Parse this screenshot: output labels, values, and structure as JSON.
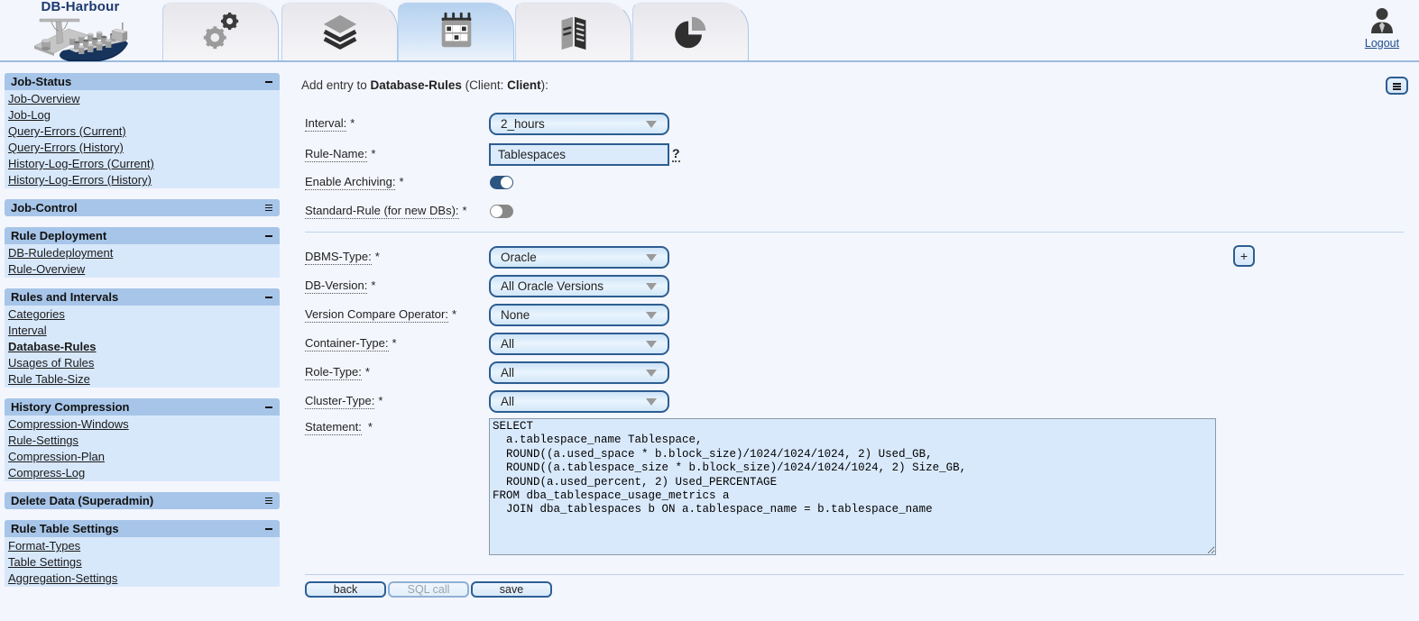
{
  "app": {
    "name": "DB-Harbour",
    "logout_label": "Logout"
  },
  "tabs": [
    {
      "id": "settings",
      "icon": "gears-icon",
      "active": false
    },
    {
      "id": "layers",
      "icon": "layers-icon",
      "active": false
    },
    {
      "id": "scheduler",
      "icon": "calendar-icon",
      "active": true
    },
    {
      "id": "reports",
      "icon": "report-icon",
      "active": false
    },
    {
      "id": "statistics",
      "icon": "pie-chart-icon",
      "active": false
    }
  ],
  "sidebar": {
    "sections": [
      {
        "title": "Job-Status",
        "state": "expanded",
        "items": [
          {
            "label": "Job-Overview"
          },
          {
            "label": "Job-Log"
          },
          {
            "label": "Query-Errors (Current)"
          },
          {
            "label": "Query-Errors (History)"
          },
          {
            "label": "History-Log-Errors (Current)"
          },
          {
            "label": "History-Log-Errors (History)"
          }
        ]
      },
      {
        "title": "Job-Control",
        "state": "collapsed",
        "items": []
      },
      {
        "title": "Rule Deployment",
        "state": "expanded",
        "items": [
          {
            "label": "DB-Ruledeployment"
          },
          {
            "label": "Rule-Overview"
          }
        ]
      },
      {
        "title": "Rules and Intervals",
        "state": "expanded",
        "items": [
          {
            "label": "Categories"
          },
          {
            "label": "Interval"
          },
          {
            "label": "Database-Rules",
            "current": true
          },
          {
            "label": "Usages of Rules"
          },
          {
            "label": "Rule Table-Size"
          }
        ]
      },
      {
        "title": "History Compression",
        "state": "expanded",
        "items": [
          {
            "label": "Compression-Windows"
          },
          {
            "label": "Rule-Settings"
          },
          {
            "label": "Compression-Plan"
          },
          {
            "label": "Compress-Log"
          }
        ]
      },
      {
        "title": "Delete Data (Superadmin)",
        "state": "collapsed",
        "items": []
      },
      {
        "title": "Rule Table Settings",
        "state": "expanded",
        "items": [
          {
            "label": "Format-Types"
          },
          {
            "label": "Table Settings"
          },
          {
            "label": "Aggregation-Settings"
          }
        ]
      }
    ]
  },
  "main": {
    "title": {
      "prefix": "Add entry to ",
      "entity": "Database-Rules",
      "mid": " (Client: ",
      "client": "Client",
      "suffix": "):"
    },
    "form": {
      "interval": {
        "label": "Interval:",
        "required": "*",
        "value": "2_hours"
      },
      "rule_name": {
        "label": "Rule-Name:",
        "required": "*",
        "value": "Tablespaces",
        "help": "?"
      },
      "enable_archiving": {
        "label": "Enable Archiving:",
        "required": "*",
        "state": "on"
      },
      "standard_rule": {
        "label": "Standard-Rule (for new DBs):",
        "required": "*",
        "state": "off"
      },
      "dbms_type": {
        "label": "DBMS-Type:",
        "required": "*",
        "value": "Oracle"
      },
      "db_version": {
        "label": "DB-Version:",
        "required": "*",
        "value": "All Oracle Versions"
      },
      "version_compare_operator": {
        "label": "Version Compare Operator:",
        "required": "*",
        "value": "None"
      },
      "container_type": {
        "label": "Container-Type:",
        "required": "*",
        "value": "All"
      },
      "role_type": {
        "label": "Role-Type:",
        "required": "*",
        "value": "All"
      },
      "cluster_type": {
        "label": "Cluster-Type:",
        "required": "*",
        "value": "All"
      },
      "statement": {
        "label": "Statement:",
        "required": "*",
        "value": "SELECT\n  a.tablespace_name Tablespace,\n  ROUND((a.used_space * b.block_size)/1024/1024/1024, 2) Used_GB,\n  ROUND((a.tablespace_size * b.block_size)/1024/1024/1024, 2) Size_GB,\n  ROUND(a.used_percent, 2) Used_PERCENTAGE\nFROM dba_tablespace_usage_metrics a\n  JOIN dba_tablespaces b ON a.tablespace_name = b.tablespace_name"
      }
    },
    "buttons": {
      "back": "back",
      "sql_call": "SQL call",
      "save": "save",
      "add": "+"
    }
  },
  "colors": {
    "accent_navy": "#2d5d91",
    "section_header": "#a7c5e8",
    "section_body": "#d8e8fb",
    "control_bg": "#dcebfb",
    "toggle_on": "#2b5581",
    "toggle_off": "#888888",
    "page_bg": "#f4f6fd"
  }
}
